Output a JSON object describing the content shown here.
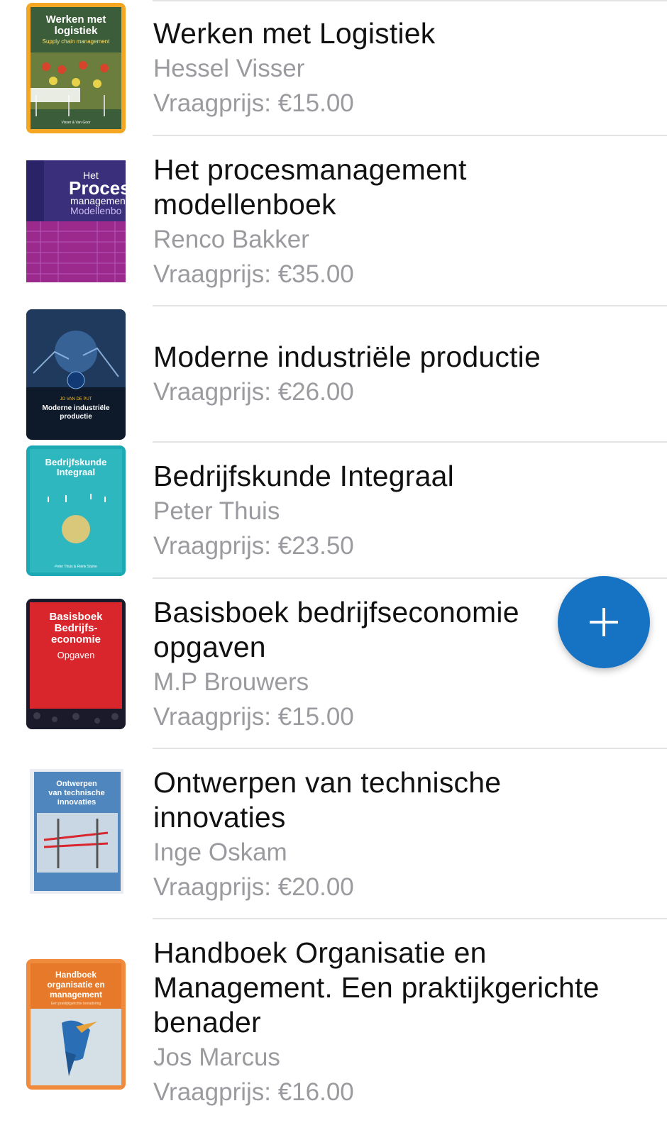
{
  "books": [
    {
      "title_lines": [
        "Werken met Logistiek"
      ],
      "author": "Hessel Visser",
      "price": "Vraagprijs: €15.00",
      "cover": {
        "title": [
          "Werken met",
          "logistiek"
        ],
        "subtitle": "Supply chain management",
        "bg": "#f5a623",
        "authors": "Visser & Van Goor"
      }
    },
    {
      "title_lines": [
        "Het procesmanagement",
        "modellenboek"
      ],
      "author": "Renco Bakker",
      "price": "Vraagprijs: €35.00",
      "cover": {
        "title": [
          "Het",
          "Proces",
          "managemen",
          "Modellenbo"
        ],
        "bg": "#3a2f7a"
      }
    },
    {
      "title_lines": [
        "Moderne industriële productie"
      ],
      "author": "",
      "price": "Vraagprijs: €26.00",
      "cover": {
        "title": [
          "Moderne industriële",
          "productie"
        ],
        "author": "JO VAN DE PUT",
        "bg": "#0e1a2a"
      }
    },
    {
      "title_lines": [
        "Bedrijfskunde Integraal"
      ],
      "author": "Peter Thuis",
      "price": "Vraagprijs: €23.50",
      "cover": {
        "title": [
          "Bedrijfskunde",
          "Integraal"
        ],
        "authors": "Peter Thuis & Rienk Stuive",
        "bg": "#1ba9b3"
      }
    },
    {
      "title_lines": [
        "Basisboek bedrijfseconomie",
        "opgaven"
      ],
      "author": "M.P Brouwers",
      "price": "Vraagprijs: €15.00",
      "cover": {
        "title": [
          "Basisboek",
          "Bedrijfs-",
          "economie"
        ],
        "subtitle": "Opgaven",
        "bg": "#d9262c"
      }
    },
    {
      "title_lines": [
        "Ontwerpen van technische",
        "innovaties"
      ],
      "author": "Inge Oskam",
      "price": "Vraagprijs: €20.00",
      "cover": {
        "title": [
          "Ontwerpen",
          "van technische",
          "innovaties"
        ],
        "bg": "#4f86bd"
      }
    },
    {
      "title_lines": [
        "Handboek Organisatie en",
        "Management. Een praktijkgerichte",
        "benader"
      ],
      "author": "Jos Marcus",
      "price": "Vraagprijs: €16.00",
      "cover": {
        "title": [
          "Handboek",
          "organisatie en",
          "management"
        ],
        "subtitle": "Een praktijkgerichte benadering",
        "bg": "#f08a3c"
      }
    }
  ],
  "fab": {
    "icon": "plus-icon"
  }
}
